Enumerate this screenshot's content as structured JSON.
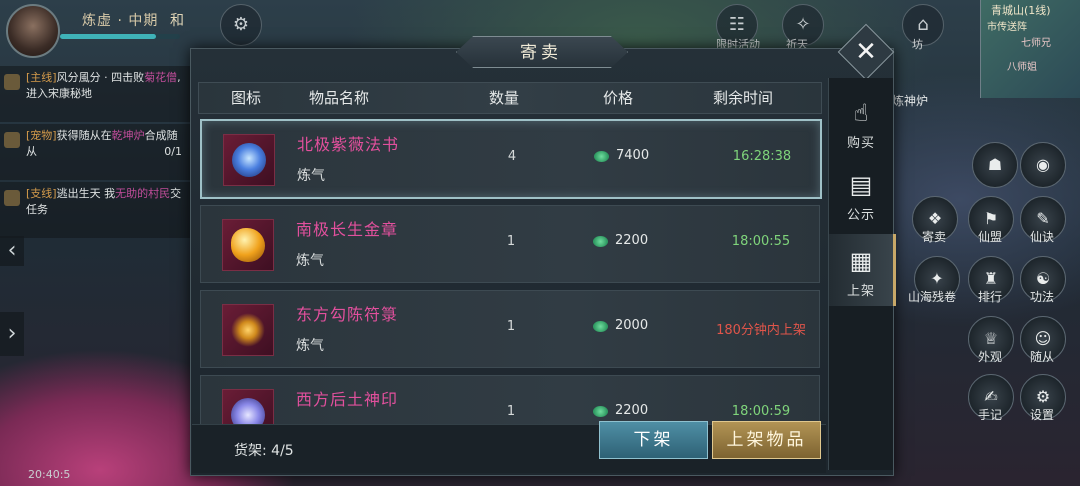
{
  "hud": {
    "character": {
      "name": "炼虚 · 中期",
      "extra": "和"
    },
    "top_menu": [
      {
        "label": "限时活动",
        "icon": "activity-icon"
      },
      {
        "label": "祈天",
        "icon": "prayer-icon"
      },
      {
        "label": "坊",
        "icon": "market-icon"
      }
    ],
    "minimap": {
      "title": "青城山(1线)",
      "place": "市传送阵",
      "npc1": "七师兄",
      "npc2": "八师姐"
    },
    "quests": [
      {
        "tag": "[主线]",
        "text": "风分風分 · 四击败",
        "hl": "菊花僧",
        "more": ",进入宋康秘地",
        "progress": ""
      },
      {
        "tag": "[宠物]",
        "text": "获得随从在",
        "hl": "乾坤炉",
        "more": "合成随从",
        "progress": "0/1"
      },
      {
        "tag": "[支线]",
        "text": "逃出生天 我",
        "hl": "无助的村民",
        "more": "交任务",
        "progress": ""
      }
    ],
    "clock": "20:40:5",
    "right_menu": [
      {
        "label": "寄卖",
        "icon": "consign-icon"
      },
      {
        "label": "仙盟",
        "icon": "alliance-icon"
      },
      {
        "label": "仙诀",
        "icon": "scroll-icon"
      },
      {
        "label": "山海残卷",
        "icon": "map-scroll-icon"
      },
      {
        "label": "排行",
        "icon": "ranking-icon"
      },
      {
        "label": "功法",
        "icon": "skill-icon"
      },
      {
        "label": "外观",
        "icon": "appearance-icon"
      },
      {
        "label": "随从",
        "icon": "follower-icon"
      },
      {
        "label": "手记",
        "icon": "journal-icon"
      },
      {
        "label": "设置",
        "icon": "settings-icon"
      }
    ],
    "right_top_labels": [
      "炼神炉"
    ]
  },
  "dialog": {
    "title": "寄卖",
    "columns": {
      "icon": "图标",
      "name": "物品名称",
      "qty": "数量",
      "price": "价格",
      "time": "剩余时间"
    },
    "items": [
      {
        "name": "北极紫薇法书",
        "sub": "炼气",
        "qty": "4",
        "price": "7400",
        "time": "16:28:38",
        "status": "selling",
        "icon": "blue-orb-icon",
        "color": "#4a7fe0"
      },
      {
        "name": "南极长生金章",
        "sub": "炼气",
        "qty": "1",
        "price": "2200",
        "time": "18:00:55",
        "status": "selling",
        "icon": "gold-seal-icon",
        "color": "#f0a21c"
      },
      {
        "name": "东方勾陈符箓",
        "sub": "炼气",
        "qty": "1",
        "price": "2000",
        "time": "180分钟内上架",
        "status": "pending",
        "icon": "golden-talisman-icon",
        "color": "#d08a1c"
      },
      {
        "name": "西方后土神印",
        "sub": "",
        "qty": "1",
        "price": "2200",
        "time": "18:00:59",
        "status": "selling",
        "icon": "crystal-seal-icon",
        "color": "#8a88e8"
      }
    ],
    "shelf_label": "货架: 4/5",
    "buttons": {
      "unlist": "下架",
      "list": "上架物品"
    },
    "tabs": [
      {
        "label": "购买",
        "icon": "buy-hand-icon",
        "active": false
      },
      {
        "label": "公示",
        "icon": "notice-board-icon",
        "active": false
      },
      {
        "label": "上架",
        "icon": "list-item-icon",
        "active": true
      }
    ]
  }
}
